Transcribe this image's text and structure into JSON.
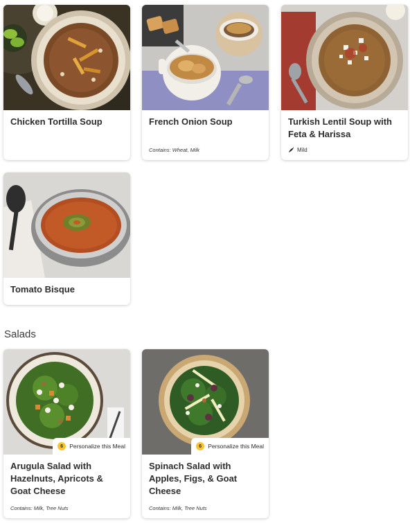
{
  "cards": [
    {
      "title": "Chicken Tortilla Soup",
      "image": "chicken-tortilla-soup-photo"
    },
    {
      "title": "French Onion Soup",
      "contains_label": "Contains:",
      "contains": "Wheat, Milk",
      "image": "french-onion-soup-photo"
    },
    {
      "title": "Turkish Lentil Soup with Feta & Harissa",
      "spice_level": "Mild",
      "spice_icon": "chili-pepper-icon",
      "image": "turkish-lentil-soup-photo"
    },
    {
      "title": "Tomato Bisque",
      "image": "tomato-bisque-photo"
    }
  ],
  "salads_section": {
    "heading": "Salads",
    "cards": [
      {
        "title": "Arugula Salad with Hazelnuts, Apricots & Goat Cheese",
        "contains_label": "Contains:",
        "contains": "Milk, Tree Nuts",
        "personalize_count": "6",
        "personalize_label": "Personalize this Meal",
        "image": "arugula-salad-photo"
      },
      {
        "title": "Spinach Salad with Apples, Figs, & Goat Cheese",
        "contains_label": "Contains:",
        "contains": "Milk, Tree Nuts",
        "personalize_count": "6",
        "personalize_label": "Personalize this Meal",
        "image": "spinach-salad-photo"
      }
    ]
  },
  "colors": {
    "badge": "#f4c634",
    "text": "#2d2d2d"
  }
}
